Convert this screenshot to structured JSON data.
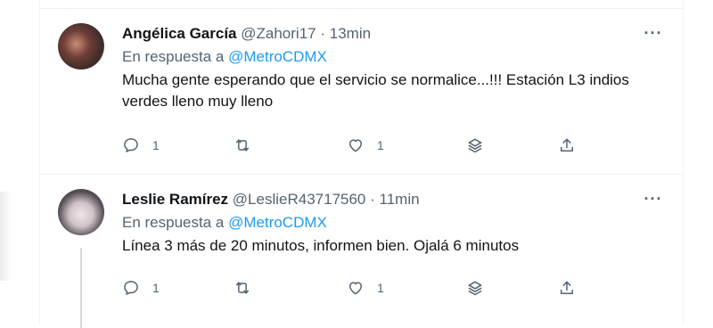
{
  "tweets": [
    {
      "author_name": "Angélica García",
      "handle": "@Zahori17",
      "separator": "·",
      "time": "13min",
      "reply_prefix": "En respuesta a",
      "reply_to": "@MetroCDMX",
      "text": "Mucha gente esperando que el servicio se normalice...!!! Estación L3 indios verdes lleno muy lleno",
      "replies": "1",
      "retweets": "",
      "likes": "1",
      "more_label": "···"
    },
    {
      "author_name": "Leslie Ramírez",
      "handle": "@LeslieR43717560",
      "separator": "·",
      "time": "11min",
      "reply_prefix": "En respuesta a",
      "reply_to": "@MetroCDMX",
      "text": "Línea 3 más de 20 minutos, informen bien. Ojalá 6 minutos",
      "replies": "1",
      "retweets": "",
      "likes": "1",
      "more_label": "···"
    }
  ],
  "icons": {
    "reply": "reply-icon",
    "retweet": "retweet-icon",
    "like": "heart-icon",
    "stack": "layers-icon",
    "share": "share-icon"
  },
  "colors": {
    "accent": "#1d9bf0",
    "secondary_text": "#536471",
    "primary_text": "#0f1419",
    "border": "#eff3f4"
  }
}
